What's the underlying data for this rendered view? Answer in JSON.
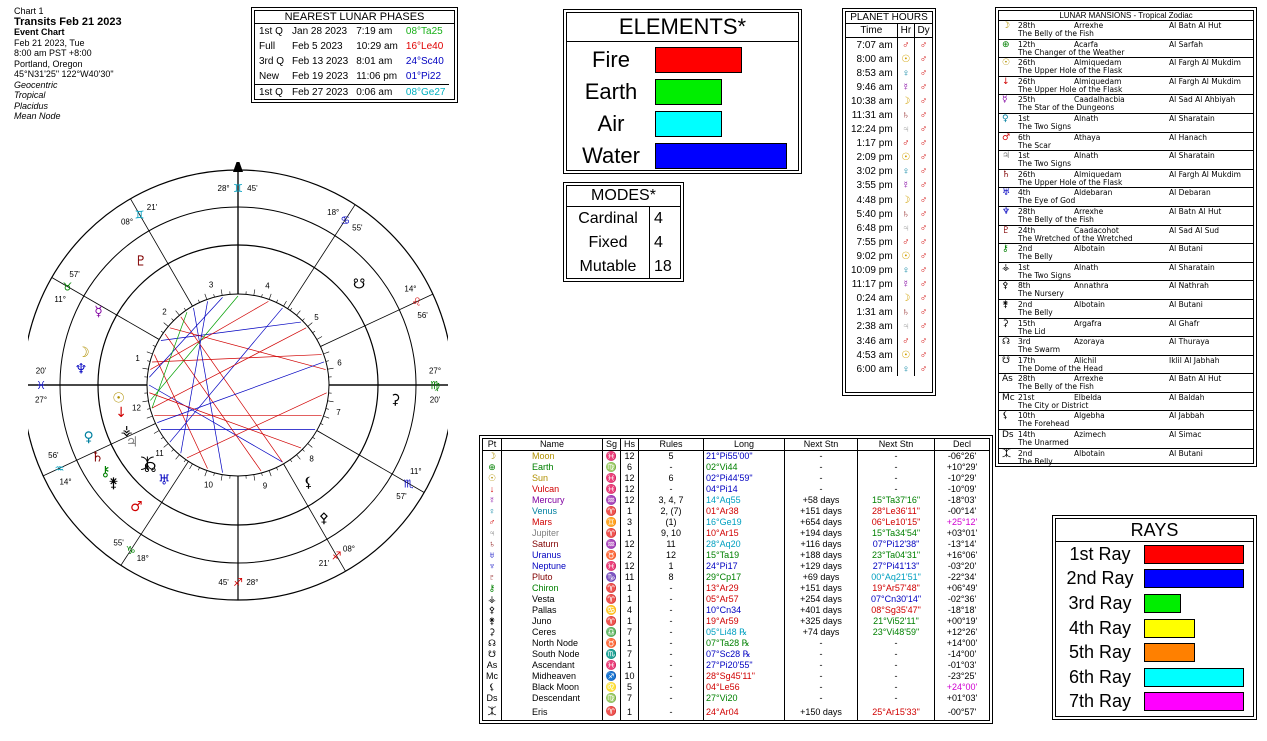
{
  "header": {
    "line1": "Chart 1",
    "line2": "Transits Feb 21 2023",
    "line3": "Event Chart",
    "line4": "Feb 21 2023, Tue",
    "line5": "8:00 am  PST +8:00",
    "line6": "Portland, Oregon",
    "line7": "45°N31'25\"  122°W40'30\"",
    "line8": "Geocentric",
    "line9": "Tropical",
    "line10": "Placidus",
    "line11": "Mean Node"
  },
  "lunar_phases": {
    "title": "NEAREST LUNAR PHASES",
    "rows": [
      {
        "phase": "1st Q",
        "date": "Jan 28 2023",
        "time": "7:19 am",
        "pos": "08°Ta25",
        "color": "#18b018"
      },
      {
        "phase": "Full",
        "date": "Feb 5 2023",
        "time": "10:29 am",
        "pos": "16°Le40",
        "color": "#e00000"
      },
      {
        "phase": "3rd Q",
        "date": "Feb 13 2023",
        "time": "8:01 am",
        "pos": "24°Sc40",
        "color": "#0000c0"
      },
      {
        "phase": "New",
        "date": "Feb 19 2023",
        "time": "11:06 pm",
        "pos": "01°Pi22",
        "color": "#0000c0"
      },
      {
        "phase": "1st Q",
        "date": "Feb 27 2023",
        "time": "0:06 am",
        "pos": "08°Ge27",
        "color": "#00b0c0"
      }
    ]
  },
  "elements": {
    "title": "ELEMENTS*",
    "items": [
      {
        "name": "Fire",
        "value": 13,
        "color": "#ff0000"
      },
      {
        "name": "Earth",
        "value": 10,
        "color": "#00ee00"
      },
      {
        "name": "Air",
        "value": 10,
        "color": "#00ffff"
      },
      {
        "name": "Water",
        "value": 20,
        "color": "#0000ff"
      }
    ]
  },
  "modes": {
    "title": "MODES*",
    "items": [
      {
        "name": "Cardinal",
        "value": "4"
      },
      {
        "name": "Fixed",
        "value": "4"
      },
      {
        "name": "Mutable",
        "value": "18"
      }
    ]
  },
  "planet_hours": {
    "title": "PLANET HOURS",
    "headers": [
      "Time",
      "Hr",
      "Dy"
    ],
    "rows": [
      {
        "time": "7:07 am",
        "hr": "♂",
        "hc": "#d00000"
      },
      {
        "time": "8:00 am",
        "hr": "☉",
        "hc": "#d0a000"
      },
      {
        "time": "8:53 am",
        "hr": "♀",
        "hc": "#0080a0"
      },
      {
        "time": "9:46 am",
        "hr": "☿",
        "hc": "#8000a0"
      },
      {
        "time": "10:38 am",
        "hr": "☽",
        "hc": "#d0a000"
      },
      {
        "time": "11:31 am",
        "hr": "♄",
        "hc": "#800000"
      },
      {
        "time": "12:24 pm",
        "hr": "♃",
        "hc": "#a0a0a0"
      },
      {
        "time": "1:17 pm",
        "hr": "♂",
        "hc": "#d00000"
      },
      {
        "time": "2:09 pm",
        "hr": "☉",
        "hc": "#d0a000"
      },
      {
        "time": "3:02 pm",
        "hr": "♀",
        "hc": "#0080a0"
      },
      {
        "time": "3:55 pm",
        "hr": "☿",
        "hc": "#8000a0"
      },
      {
        "time": "4:48 pm",
        "hr": "☽",
        "hc": "#d0a000"
      },
      {
        "time": "5:40 pm",
        "hr": "♄",
        "hc": "#800000"
      },
      {
        "time": "6:48 pm",
        "hr": "♃",
        "hc": "#a0a0a0"
      },
      {
        "time": "7:55 pm",
        "hr": "♂",
        "hc": "#d00000"
      },
      {
        "time": "9:02 pm",
        "hr": "☉",
        "hc": "#d0a000"
      },
      {
        "time": "10:09 pm",
        "hr": "♀",
        "hc": "#0080a0"
      },
      {
        "time": "11:17 pm",
        "hr": "☿",
        "hc": "#8000a0"
      },
      {
        "time": "0:24 am",
        "hr": "☽",
        "hc": "#d0a000"
      },
      {
        "time": "1:31 am",
        "hr": "♄",
        "hc": "#800000"
      },
      {
        "time": "2:38 am",
        "hr": "♃",
        "hc": "#a0a0a0"
      },
      {
        "time": "3:46 am",
        "hr": "♂",
        "hc": "#d00000"
      },
      {
        "time": "4:53 am",
        "hr": "☉",
        "hc": "#d0a000"
      },
      {
        "time": "6:00 am",
        "hr": "♀",
        "hc": "#0080a0"
      }
    ],
    "day_glyph": "♂"
  },
  "mansions": {
    "title": "LUNAR MANSIONS - Tropical Zodiac",
    "rows": [
      {
        "g": "☽",
        "c": "#b09000",
        "n": "28th",
        "a": "Arrexhe",
        "b": "Al Batn Al Hut",
        "m": "The Belly of the Fish"
      },
      {
        "g": "⊕",
        "c": "#008000",
        "n": "12th",
        "a": "Acarfa",
        "b": "Al Sarfah",
        "m": "The Changer of the Weather"
      },
      {
        "g": "☉",
        "c": "#b09000",
        "n": "26th",
        "a": "Almiquedam",
        "b": "Al Fargh Al Mukdim",
        "m": "The Upper Hole of the Flask"
      },
      {
        "g": "↓",
        "c": "#d00000",
        "n": "26th",
        "a": "Almiquedam",
        "b": "Al Fargh Al Mukdim",
        "m": "The Upper Hole of the Flask"
      },
      {
        "g": "☿",
        "c": "#8000a0",
        "n": "25th",
        "a": "Caadalhacbia",
        "b": "Al Sad Al Ahbiyah",
        "m": "The Star of the Dungeons"
      },
      {
        "g": "♀",
        "c": "#0080a0",
        "n": "1st",
        "a": "Alnath",
        "b": "Al Sharatain",
        "m": "The Two Signs"
      },
      {
        "g": "♂",
        "c": "#d00000",
        "n": "6th",
        "a": "Athaya",
        "b": "Al Hanach",
        "m": "The Scar"
      },
      {
        "g": "♃",
        "c": "#808080",
        "n": "1st",
        "a": "Alnath",
        "b": "Al Sharatain",
        "m": "The Two Signs"
      },
      {
        "g": "♄",
        "c": "#800000",
        "n": "26th",
        "a": "Almiquedam",
        "b": "Al Fargh Al Mukdim",
        "m": "The Upper Hole of the Flask"
      },
      {
        "g": "♅",
        "c": "#0000c0",
        "n": "4th",
        "a": "Aldebaran",
        "b": "Al Debaran",
        "m": "The Eye of God"
      },
      {
        "g": "♆",
        "c": "#0000c0",
        "n": "28th",
        "a": "Arrexhe",
        "b": "Al Batn Al Hut",
        "m": "The Belly of the Fish"
      },
      {
        "g": "♇",
        "c": "#800000",
        "n": "24th",
        "a": "Caadacohot",
        "b": "Al Sad Al Sud",
        "m": "The Wretched of the Wretched"
      },
      {
        "g": "⚷",
        "c": "#008000",
        "n": "2nd",
        "a": "Albotain",
        "b": "Al Butani",
        "m": "The Belly"
      },
      {
        "g": "⚶",
        "c": "#000000",
        "n": "1st",
        "a": "Alnath",
        "b": "Al Sharatain",
        "m": "The Two Signs"
      },
      {
        "g": "⚴",
        "c": "#000000",
        "n": "8th",
        "a": "Annathra",
        "b": "Al Nathrah",
        "m": "The Nursery"
      },
      {
        "g": "⚵",
        "c": "#000000",
        "n": "2nd",
        "a": "Albotain",
        "b": "Al Butani",
        "m": "The Belly"
      },
      {
        "g": "⚳",
        "c": "#000000",
        "n": "15th",
        "a": "Argafra",
        "b": "Al Ghafr",
        "m": "The Lid"
      },
      {
        "g": "☊",
        "c": "#000000",
        "n": "3rd",
        "a": "Azoraya",
        "b": "Al Thuraya",
        "m": "The Swarm"
      },
      {
        "g": "☋",
        "c": "#000000",
        "n": "17th",
        "a": "Alichil",
        "b": "Iklil Al Jabhah",
        "m": "The Dome of the Head"
      },
      {
        "g": "As",
        "c": "#000000",
        "n": "28th",
        "a": "Arrexhe",
        "b": "Al Batn Al Hut",
        "m": "The Belly of the Fish"
      },
      {
        "g": "Mc",
        "c": "#000000",
        "n": "21st",
        "a": "Elbelda",
        "b": "Al Baldah",
        "m": "The City or District"
      },
      {
        "g": "⚸",
        "c": "#000000",
        "n": "10th",
        "a": "Algebha",
        "b": "Al Jabbah",
        "m": "The Forehead"
      },
      {
        "g": "Ds",
        "c": "#000000",
        "n": "14th",
        "a": "Azimech",
        "b": "Al Simac",
        "m": "The Unarmed"
      },
      {
        "g": "⯰",
        "c": "#000000",
        "n": "2nd",
        "a": "Albotain",
        "b": "Al Butani",
        "m": "The Belly"
      }
    ]
  },
  "planets": {
    "headers": [
      "Pt",
      "Name",
      "Sg",
      "Hs",
      "Rules",
      "Long",
      "Next Stn",
      "Next Stn",
      "Decl"
    ],
    "rows": [
      {
        "g": "☽",
        "name": "Moon",
        "nc": "#b09000",
        "sg": "♓",
        "hs": "12",
        "rules": "5",
        "long": "21°Pi55'00\"",
        "lc": "#0000c0",
        "s1": "-",
        "s2": "-",
        "s2c": "#000",
        "decl": "-06°26'",
        "dc": "#000"
      },
      {
        "g": "⊕",
        "name": "Earth",
        "nc": "#008000",
        "sg": "♍",
        "hs": "6",
        "rules": "-",
        "long": "02°Vi44",
        "lc": "#008000",
        "s1": "-",
        "s2": "-",
        "s2c": "#000",
        "decl": "+10°29'",
        "dc": "#000"
      },
      {
        "g": "☉",
        "name": "Sun",
        "nc": "#b09000",
        "sg": "♓",
        "hs": "12",
        "rules": "6",
        "long": "02°Pi44'59\"",
        "lc": "#0000c0",
        "s1": "-",
        "s2": "-",
        "s2c": "#000",
        "decl": "-10°29'",
        "dc": "#000"
      },
      {
        "g": "↓",
        "name": "Vulcan",
        "nc": "#d00000",
        "sg": "♓",
        "hs": "12",
        "rules": "-",
        "long": "04°Pi14",
        "lc": "#0000c0",
        "s1": "-",
        "s2": "-",
        "s2c": "#000",
        "decl": "-10°09'",
        "dc": "#000"
      },
      {
        "g": "☿",
        "name": "Mercury",
        "nc": "#8000a0",
        "sg": "♒",
        "hs": "12",
        "rules": "3, 4, 7",
        "long": "14°Aq55",
        "lc": "#00a0c0",
        "s1": "+58 days",
        "s2": "15°Ta37'16\"",
        "s2c": "#008000",
        "decl": "-18°03'",
        "dc": "#000"
      },
      {
        "g": "♀",
        "name": "Venus",
        "nc": "#0080a0",
        "sg": "♈",
        "hs": "1",
        "rules": "2, (7)",
        "long": "01°Ar38",
        "lc": "#d00000",
        "s1": "+151 days",
        "s2": "28°Le36'11\"",
        "s2c": "#d00000",
        "decl": "-00°14'",
        "dc": "#000"
      },
      {
        "g": "♂",
        "name": "Mars",
        "nc": "#d00000",
        "sg": "♊",
        "hs": "3",
        "rules": "(1)",
        "long": "16°Ge19",
        "lc": "#00a0c0",
        "s1": "+654 days",
        "s2": "06°Le10'15\"",
        "s2c": "#d00000",
        "decl": "+25°12'",
        "dc": "#d000d0"
      },
      {
        "g": "♃",
        "name": "Jupiter",
        "nc": "#808080",
        "sg": "♈",
        "hs": "1",
        "rules": "9, 10",
        "long": "10°Ar15",
        "lc": "#d00000",
        "s1": "+194 days",
        "s2": "15°Ta34'54\"",
        "s2c": "#008000",
        "decl": "+03°01'",
        "dc": "#000"
      },
      {
        "g": "♄",
        "name": "Saturn",
        "nc": "#800000",
        "sg": "♒",
        "hs": "12",
        "rules": "11",
        "long": "28°Aq20",
        "lc": "#00a0c0",
        "s1": "+116 days",
        "s2": "07°Pi12'38\"",
        "s2c": "#0000c0",
        "decl": "-13°14'",
        "dc": "#000"
      },
      {
        "g": "♅",
        "name": "Uranus",
        "nc": "#0000c0",
        "sg": "♉",
        "hs": "2",
        "rules": "12",
        "long": "15°Ta19",
        "lc": "#008000",
        "s1": "+188 days",
        "s2": "23°Ta04'31\"",
        "s2c": "#008000",
        "decl": "+16°06'",
        "dc": "#000"
      },
      {
        "g": "♆",
        "name": "Neptune",
        "nc": "#0000c0",
        "sg": "♓",
        "hs": "12",
        "rules": "1",
        "long": "24°Pi17",
        "lc": "#0000c0",
        "s1": "+129 days",
        "s2": "27°Pi41'13\"",
        "s2c": "#0000c0",
        "decl": "-03°20'",
        "dc": "#000"
      },
      {
        "g": "♇",
        "name": "Pluto",
        "nc": "#800000",
        "sg": "♑",
        "hs": "11",
        "rules": "8",
        "long": "29°Cp17",
        "lc": "#008000",
        "s1": "+69 days",
        "s2": "00°Aq21'51\"",
        "s2c": "#00a0c0",
        "decl": "-22°34'",
        "dc": "#000"
      },
      {
        "g": "⚷",
        "name": "Chiron",
        "nc": "#008000",
        "sg": "♈",
        "hs": "1",
        "rules": "-",
        "long": "13°Ar29",
        "lc": "#d00000",
        "s1": "+151 days",
        "s2": "19°Ar57'48\"",
        "s2c": "#d00000",
        "decl": "+06°49'",
        "dc": "#000"
      },
      {
        "g": "⚶",
        "name": "Vesta",
        "nc": "#000000",
        "sg": "♈",
        "hs": "1",
        "rules": "-",
        "long": "05°Ar57",
        "lc": "#d00000",
        "s1": "+254 days",
        "s2": "07°Cn30'14\"",
        "s2c": "#0000c0",
        "decl": "-02°36'",
        "dc": "#000"
      },
      {
        "g": "⚴",
        "name": "Pallas",
        "nc": "#000000",
        "sg": "♋",
        "hs": "4",
        "rules": "-",
        "long": "10°Cn34",
        "lc": "#0000c0",
        "s1": "+401 days",
        "s2": "08°Sg35'47\"",
        "s2c": "#d00000",
        "decl": "-18°18'",
        "dc": "#000"
      },
      {
        "g": "⚵",
        "name": "Juno",
        "nc": "#000000",
        "sg": "♈",
        "hs": "1",
        "rules": "-",
        "long": "19°Ar59",
        "lc": "#d00000",
        "s1": "+325 days",
        "s2": "21°Vi52'11\"",
        "s2c": "#008000",
        "decl": "+00°19'",
        "dc": "#000"
      },
      {
        "g": "⚳",
        "name": "Ceres",
        "nc": "#000000",
        "sg": "♎",
        "hs": "7",
        "rules": "-",
        "long": "05°Li48 ℞",
        "lc": "#00a0c0",
        "s1": "+74 days",
        "s2": "23°Vi48'59\"",
        "s2c": "#008000",
        "decl": "+12°26'",
        "dc": "#000"
      },
      {
        "g": "☊",
        "name": "North Node",
        "nc": "#000000",
        "sg": "♉",
        "hs": "1",
        "rules": "-",
        "long": "07°Ta28 ℞",
        "lc": "#008000",
        "s1": "-",
        "s2": "-",
        "s2c": "#000",
        "decl": "+14°00'",
        "dc": "#000"
      },
      {
        "g": "☋",
        "name": "South Node",
        "nc": "#000000",
        "sg": "♏",
        "hs": "7",
        "rules": "-",
        "long": "07°Sc28 ℞",
        "lc": "#0000c0",
        "s1": "-",
        "s2": "-",
        "s2c": "#000",
        "decl": "-14°00'",
        "dc": "#000"
      },
      {
        "g": "As",
        "name": "Ascendant",
        "nc": "#000000",
        "sg": "♓",
        "hs": "1",
        "rules": "-",
        "long": "27°Pi20'55\"",
        "lc": "#0000c0",
        "s1": "-",
        "s2": "-",
        "s2c": "#000",
        "decl": "-01°03'",
        "dc": "#000"
      },
      {
        "g": "Mc",
        "name": "Midheaven",
        "nc": "#000000",
        "sg": "♐",
        "hs": "10",
        "rules": "-",
        "long": "28°Sg45'11\"",
        "lc": "#d00000",
        "s1": "-",
        "s2": "-",
        "s2c": "#000",
        "decl": "-23°25'",
        "dc": "#000"
      },
      {
        "g": "⚸",
        "name": "Black Moon",
        "nc": "#000000",
        "sg": "♌",
        "hs": "5",
        "rules": "-",
        "long": "04°Le56",
        "lc": "#d00000",
        "s1": "-",
        "s2": "-",
        "s2c": "#000",
        "decl": "+24°00'",
        "dc": "#d000d0"
      },
      {
        "g": "Ds",
        "name": "Descendant",
        "nc": "#000000",
        "sg": "♍",
        "hs": "7",
        "rules": "-",
        "long": "27°Vi20",
        "lc": "#008000",
        "s1": "-",
        "s2": "-",
        "s2c": "#000",
        "decl": "+01°03'",
        "dc": "#000"
      },
      {
        "g": "⯰",
        "name": "Eris",
        "nc": "#000000",
        "sg": "♈",
        "hs": "1",
        "rules": "-",
        "long": "24°Ar04",
        "lc": "#d00000",
        "s1": "+150 days",
        "s2": "25°Ar15'33\"",
        "s2c": "#d00000",
        "decl": "-00°57'",
        "dc": "#000"
      }
    ]
  },
  "rays": {
    "title": "RAYS",
    "items": [
      {
        "name": "1st Ray",
        "value": 14,
        "color": "#ff0000"
      },
      {
        "name": "2nd Ray",
        "value": 14,
        "color": "#0000ff"
      },
      {
        "name": "3rd Ray",
        "value": 5,
        "color": "#00ee00"
      },
      {
        "name": "4th Ray",
        "value": 7,
        "color": "#ffff00"
      },
      {
        "name": "5th Ray",
        "value": 7,
        "color": "#ff8000"
      },
      {
        "name": "6th Ray",
        "value": 14,
        "color": "#00ffff"
      },
      {
        "name": "7th Ray",
        "value": 14,
        "color": "#ff00ff"
      }
    ]
  },
  "wheel": {
    "house_numbers": [
      "1",
      "2",
      "3",
      "4",
      "5",
      "6",
      "7",
      "8",
      "9",
      "10",
      "11",
      "12"
    ],
    "cusp_labels": [
      {
        "deg": "27°",
        "sign": "♓",
        "min": "20'",
        "c": "#0000c0"
      },
      {
        "deg": "11°",
        "sign": "♉",
        "min": "57'",
        "c": "#008000"
      },
      {
        "deg": "08°",
        "sign": "♊",
        "min": "21'",
        "c": "#00a0c0"
      },
      {
        "deg": "28°",
        "sign": "♊",
        "min": "45'",
        "c": "#00a0c0"
      },
      {
        "deg": "18°",
        "sign": "♋",
        "min": "55'",
        "c": "#0000c0"
      },
      {
        "deg": "14°",
        "sign": "♌",
        "min": "56'",
        "c": "#d00000"
      },
      {
        "deg": "27°",
        "sign": "♍",
        "min": "20'",
        "c": "#008000"
      },
      {
        "deg": "11°",
        "sign": "♏",
        "min": "57'",
        "c": "#0000c0"
      },
      {
        "deg": "08°",
        "sign": "♐",
        "min": "21'",
        "c": "#d00000"
      },
      {
        "deg": "28°",
        "sign": "♐",
        "min": "45'",
        "c": "#d00000"
      },
      {
        "deg": "18°",
        "sign": "♑",
        "min": "55'",
        "c": "#008000"
      },
      {
        "deg": "14°",
        "sign": "♒",
        "min": "56'",
        "c": "#00a0c0"
      }
    ]
  }
}
